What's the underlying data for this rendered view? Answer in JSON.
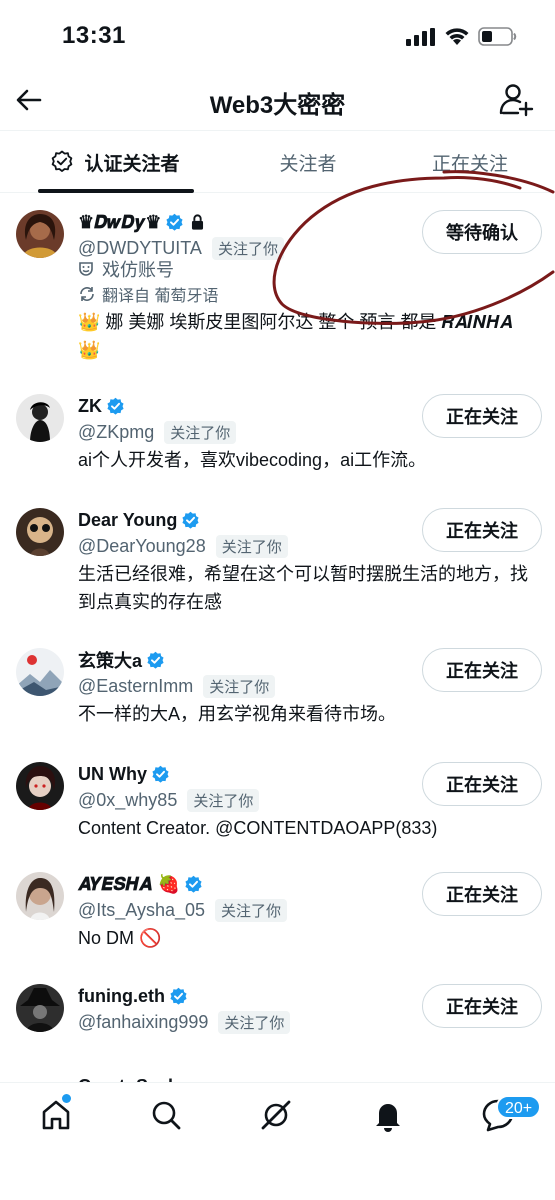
{
  "status_bar": {
    "time": "13:31"
  },
  "header": {
    "title": "Web3大密密"
  },
  "tabs": [
    {
      "label": "认证关注者",
      "active": true
    },
    {
      "label": "关注者",
      "active": false
    },
    {
      "label": "正在关注",
      "active": false
    }
  ],
  "users": [
    {
      "name": "♛𝑫𝒘𝑫𝒚♛",
      "handle": "@DWDYTUITA",
      "follows_you": "关注了你",
      "parody_label": "戏仿账号",
      "translate_label": "翻译自 葡萄牙语",
      "bio_line1": "👑 娜 美娜 埃斯皮里图阿尔达 整个 预言 都是 𝑹𝑨𝑰𝑵𝑯𝑨",
      "bio_line2": "👑",
      "button": "等待确认"
    },
    {
      "name": "ZK",
      "handle": "@ZKpmg",
      "follows_you": "关注了你",
      "bio": "ai个人开发者，喜欢vibecoding，ai工作流。",
      "button": "正在关注"
    },
    {
      "name": "Dear Young",
      "handle": "@DearYoung28",
      "follows_you": "关注了你",
      "bio_line1": "生活已经很难，希望在这个可以暂时摆脱生活的地方，找",
      "bio_line2": "到点真实的存在感",
      "button": "正在关注"
    },
    {
      "name": "玄策大a",
      "handle": "@EasternImm",
      "follows_you": "关注了你",
      "bio": "不一样的大A，用玄学视角来看待市场。",
      "button": "正在关注"
    },
    {
      "name": "UN Why",
      "handle": "@0x_why85",
      "follows_you": "关注了你",
      "bio": "Content Creator. @CONTENTDAOAPP(833)",
      "button": "正在关注"
    },
    {
      "name": "𝑨𝒀𝑬𝑺𝑯𝑨 🍓",
      "handle": "@Its_Aysha_05",
      "follows_you": "关注了你",
      "bio": "No DM 🚫",
      "button": "正在关注"
    },
    {
      "name": "funing.eth",
      "handle": "@fanhaixing999",
      "follows_you": "关注了你",
      "button": "正在关注"
    },
    {
      "name": "CryptoSeal"
    }
  ],
  "bottom_nav": {
    "notification_count": "20+"
  },
  "colors": {
    "accent": "#1d9bf0",
    "scribble": "#7a1a1a",
    "text": "#0f1419",
    "muted": "#536471"
  }
}
